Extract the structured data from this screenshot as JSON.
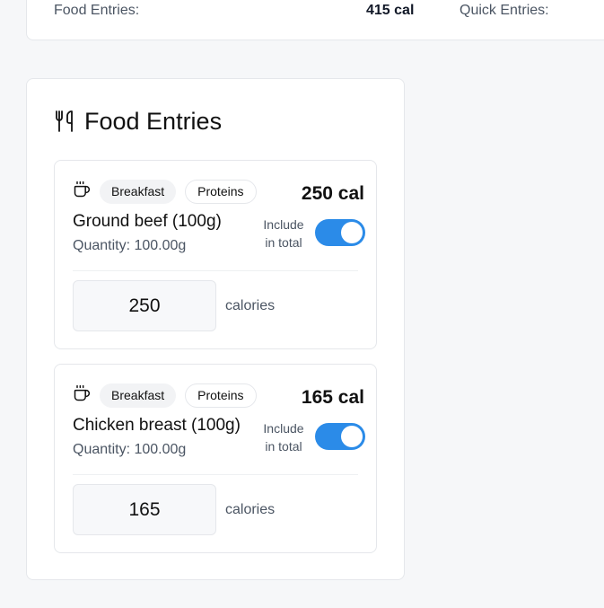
{
  "summary": {
    "food_entries_label": "Food Entries:",
    "food_entries_value": "415 cal",
    "quick_entries_label": "Quick Entries:"
  },
  "food_entries_card": {
    "title": "Food Entries",
    "icon": "utensils-icon"
  },
  "entries": [
    {
      "icon": "coffee-cup-icon",
      "meal_tag": "Breakfast",
      "category_tag": "Proteins",
      "calories_total": "250 cal",
      "name": "Ground beef (100g)",
      "quantity": "Quantity: 100.00g",
      "include_label": "Include in total",
      "include_on": true,
      "calories_value": "250",
      "calories_unit": "calories"
    },
    {
      "icon": "coffee-cup-icon",
      "meal_tag": "Breakfast",
      "category_tag": "Proteins",
      "calories_total": "165 cal",
      "name": "Chicken breast (100g)",
      "quantity": "Quantity: 100.00g",
      "include_label": "Include in total",
      "include_on": true,
      "calories_value": "165",
      "calories_unit": "calories"
    }
  ],
  "colors": {
    "toggle_on": "#2b8be8",
    "page_bg": "#f6f7f9",
    "card_bg": "#ffffff"
  }
}
